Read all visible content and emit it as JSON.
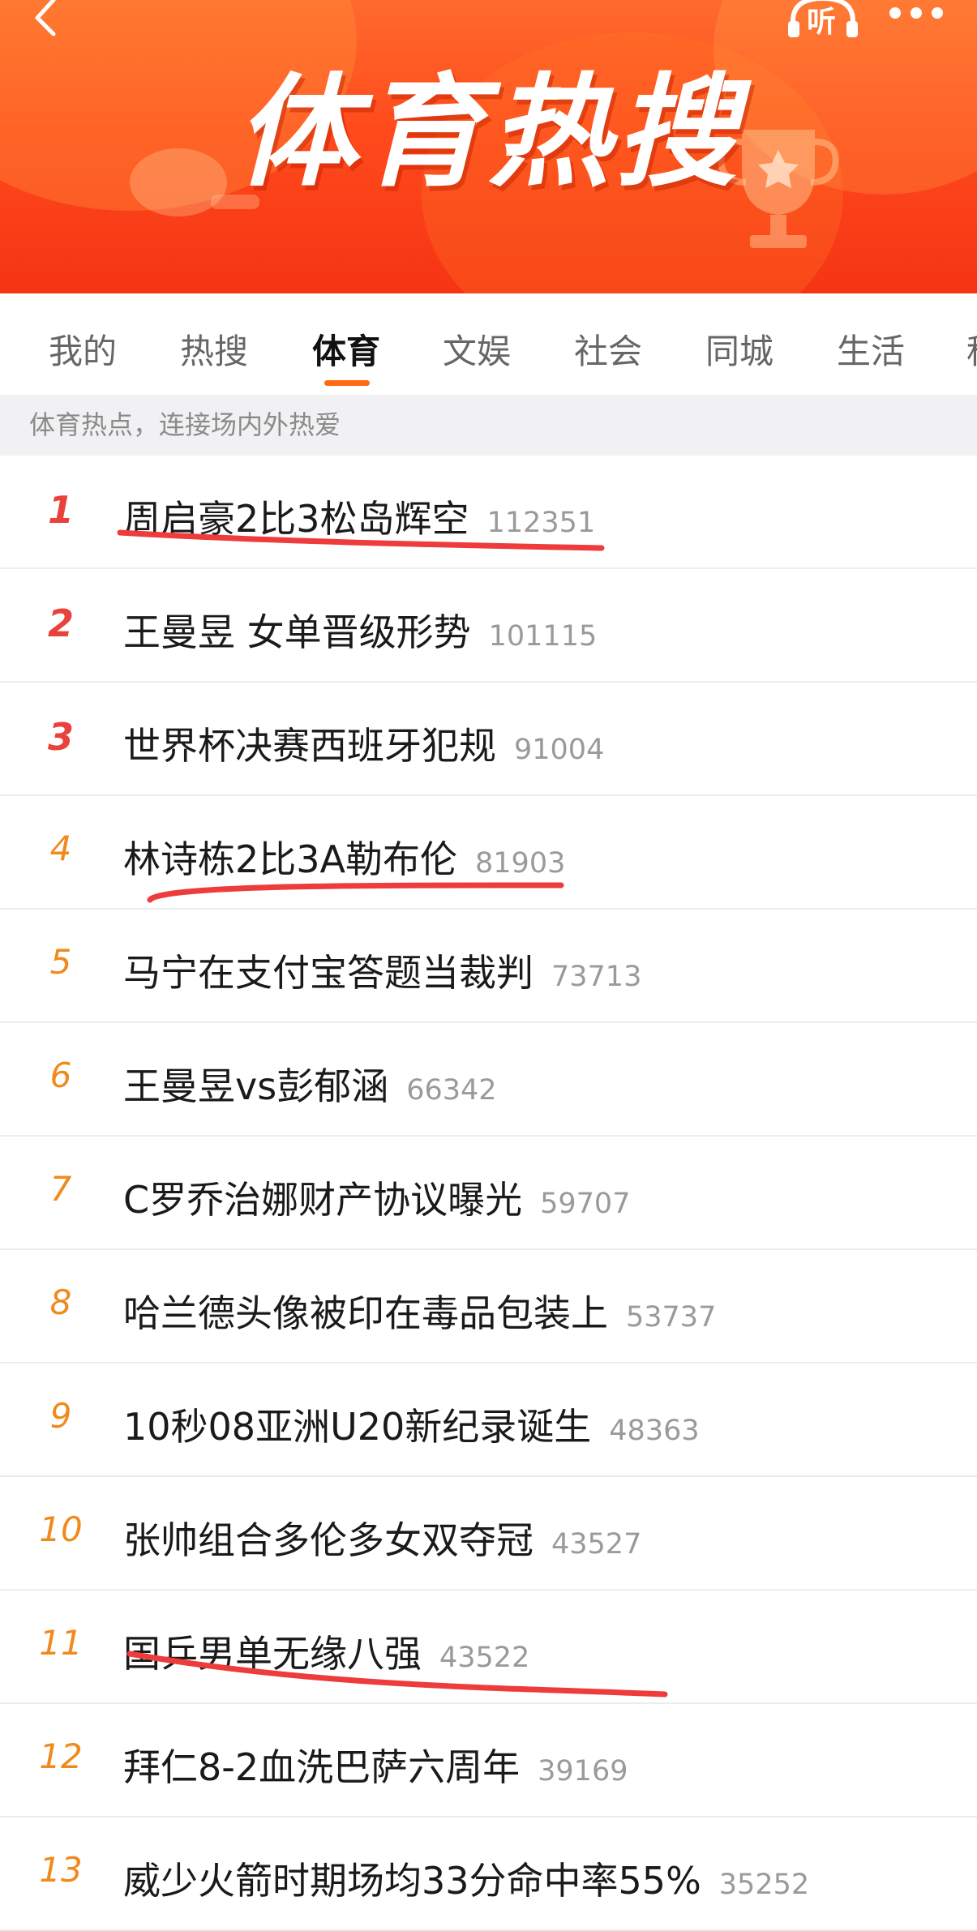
{
  "header": {
    "title": "体育热搜",
    "listen_label": "听"
  },
  "tabs": [
    {
      "label": "我的"
    },
    {
      "label": "热搜"
    },
    {
      "label": "体育",
      "active": true
    },
    {
      "label": "文娱"
    },
    {
      "label": "社会"
    },
    {
      "label": "同城"
    },
    {
      "label": "生活"
    },
    {
      "label": "科"
    }
  ],
  "subtitle": "体育热点，连接场内外热爱",
  "list": [
    {
      "rank": "1",
      "topic": "周启豪2比3松岛辉空",
      "count": "112351",
      "underlined": true
    },
    {
      "rank": "2",
      "topic": "王曼昱 女单晋级形势",
      "count": "101115"
    },
    {
      "rank": "3",
      "topic": "世界杯决赛西班牙犯规",
      "count": "91004"
    },
    {
      "rank": "4",
      "topic": "林诗栋2比3A勒布伦",
      "count": "81903",
      "underlined": true
    },
    {
      "rank": "5",
      "topic": "马宁在支付宝答题当裁判",
      "count": "73713"
    },
    {
      "rank": "6",
      "topic": "王曼昱vs彭郁涵",
      "count": "66342"
    },
    {
      "rank": "7",
      "topic": "C罗乔治娜财产协议曝光",
      "count": "59707"
    },
    {
      "rank": "8",
      "topic": "哈兰德头像被印在毒品包装上",
      "count": "53737"
    },
    {
      "rank": "9",
      "topic": "10秒08亚洲U20新纪录诞生",
      "count": "48363"
    },
    {
      "rank": "10",
      "topic": "张帅组合多伦多女双夺冠",
      "count": "43527"
    },
    {
      "rank": "11",
      "topic": "国乒男单无缘八强",
      "count": "43522",
      "underlined": true
    },
    {
      "rank": "12",
      "topic": "拜仁8-2血洗巴萨六周年",
      "count": "39169"
    },
    {
      "rank": "13",
      "topic": "威少火箭时期场均33分命中率55%",
      "count": "35252"
    }
  ],
  "colors": {
    "banner": "#ff4a1c",
    "accent": "#ff6a13",
    "rank_top": "#e9423c",
    "rank_other": "#f08a1c",
    "annotation": "#ee3b3b"
  },
  "icons": {
    "back": "chevron-left-icon",
    "listen": "headphones-icon",
    "more": "more-dots-icon"
  }
}
